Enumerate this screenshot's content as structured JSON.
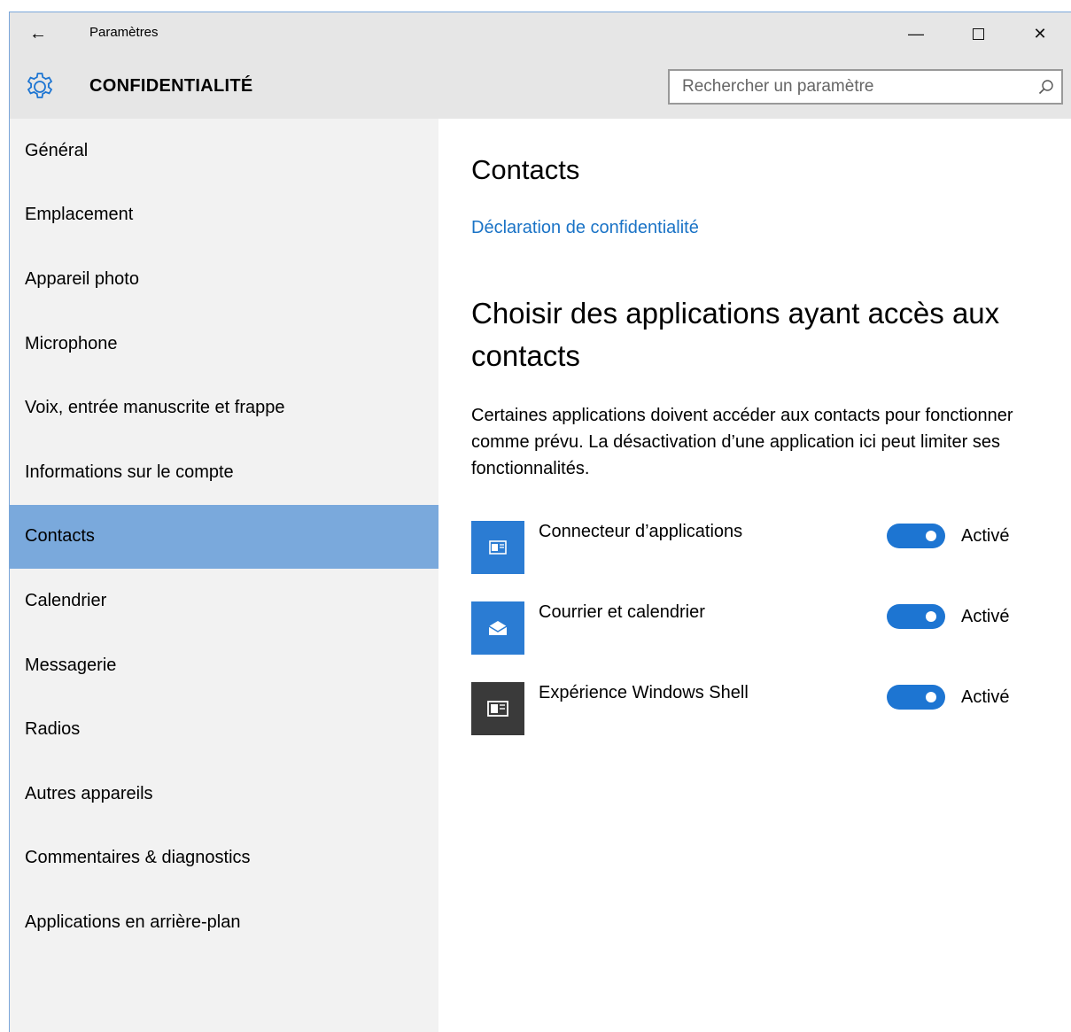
{
  "window": {
    "title": "Paramètres",
    "minimize_glyph": "—",
    "close_glyph": "✕",
    "back_glyph": "←"
  },
  "header": {
    "icon": "gear-icon",
    "title": "CONFIDENTIALITÉ",
    "search_placeholder": "Rechercher un paramètre"
  },
  "sidebar": {
    "items": [
      {
        "label": "Général"
      },
      {
        "label": "Emplacement"
      },
      {
        "label": "Appareil photo"
      },
      {
        "label": "Microphone"
      },
      {
        "label": "Voix, entrée manuscrite et frappe"
      },
      {
        "label": "Informations sur le compte"
      },
      {
        "label": "Contacts",
        "selected": true
      },
      {
        "label": "Calendrier"
      },
      {
        "label": "Messagerie"
      },
      {
        "label": "Radios"
      },
      {
        "label": "Autres appareils"
      },
      {
        "label": "Commentaires & diagnostics"
      },
      {
        "label": "Applications en arrière-plan"
      }
    ]
  },
  "main": {
    "title": "Contacts",
    "privacy_link": "Déclaration de confidentialité",
    "subtitle": "Choisir des applications ayant accès aux contacts",
    "description": "Certaines applications doivent accéder aux contacts pour fonctionner comme prévu. La désactivation d’une application ici peut limiter ses fonctionnalités.",
    "apps": [
      {
        "name": "Connecteur d’applications",
        "icon": "app-connector-icon",
        "tile_color": "#2b7cd3",
        "enabled": true,
        "state_label": "Activé"
      },
      {
        "name": "Courrier et calendrier",
        "icon": "mail-icon",
        "tile_color": "#2b7cd3",
        "enabled": true,
        "state_label": "Activé"
      },
      {
        "name": "Expérience Windows Shell",
        "icon": "windows-shell-icon",
        "tile_color": "#3a3a3a",
        "enabled": true,
        "state_label": "Activé"
      }
    ]
  },
  "colors": {
    "accent": "#1d75d2",
    "selected_nav": "#7aa9dc",
    "link": "#1a73c6"
  }
}
